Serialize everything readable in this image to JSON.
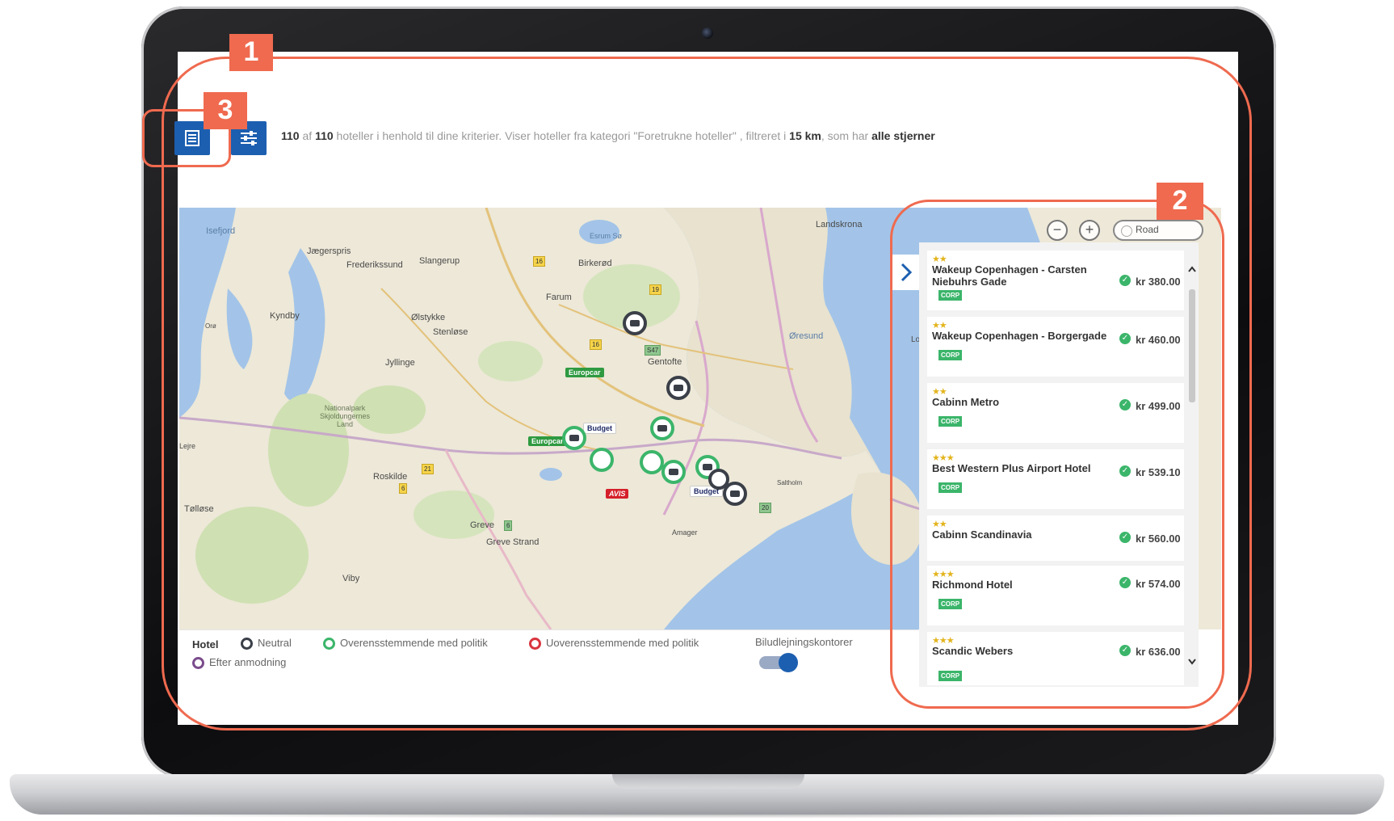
{
  "toolbar": {
    "list_view_icon": "list-icon",
    "filter_icon": "sliders-icon"
  },
  "summary": {
    "count_shown": "110",
    "of_text": "af",
    "count_total": "110",
    "text_a": "hoteller i henhold til dine kriterier. Viser hoteller fra kategori \"Foretrukne hoteller\" , filtreret i",
    "distance": "15 km",
    "text_b": ", som har",
    "stars": "alle stjerner"
  },
  "map": {
    "type_selector": "Road",
    "labels": [
      "Isefjord",
      "Jægerspris",
      "Frederikssund",
      "Slangerup",
      "Esrum Sø",
      "Birkerød",
      "Farum",
      "Kyndby",
      "Ølstykke",
      "Stenløse",
      "Jyllinge",
      "Nationalpark Skjoldungernes Land",
      "Gentofte",
      "Øresund",
      "Landskrona",
      "Roskilde",
      "Tølløse",
      "Greve",
      "Greve Strand",
      "Viby",
      "Amager",
      "Saltholm",
      "Europcar",
      "Budget",
      "AVIS",
      "Lejre",
      "Orø",
      "Lo"
    ],
    "road_numbers": [
      "16",
      "19",
      "16",
      "6",
      "21",
      "6",
      "20",
      "S47"
    ]
  },
  "legend": {
    "hotel_label": "Hotel",
    "neutral": "Neutral",
    "compliant": "Overensstemmende med politik",
    "noncompliant": "Uoverensstemmende med politik",
    "on_request": "Efter anmodning",
    "car_rental": "Biludlejningskontorer",
    "car_rental_toggle_on": true
  },
  "hotels": [
    {
      "stars": "★★",
      "name": "Wakeup Copenhagen - Carsten Niebuhrs Gade",
      "badge": "CORP",
      "price": "kr 380.00"
    },
    {
      "stars": "★★",
      "name": "Wakeup Copenhagen - Borgergade",
      "badge": "CORP",
      "price": "kr 460.00"
    },
    {
      "stars": "★★",
      "name": "Cabinn Metro",
      "badge": "CORP",
      "price": "kr 499.00"
    },
    {
      "stars": "★★★",
      "name": "Best Western Plus Airport Hotel",
      "badge": "CORP",
      "price": "kr 539.10"
    },
    {
      "stars": "★★",
      "name": "Cabinn Scandinavia",
      "badge": "",
      "price": "kr 560.00"
    },
    {
      "stars": "★★★",
      "name": "Richmond Hotel",
      "badge": "CORP",
      "price": "kr 574.00"
    },
    {
      "stars": "★★★",
      "name": "Scandic Webers",
      "badge": "CORP",
      "price": "kr 636.00"
    }
  ],
  "callouts": {
    "one": "1",
    "two": "2",
    "three": "3"
  },
  "colors": {
    "accent_blue": "#1c5fb0",
    "callout": "#ef6a4f",
    "compliant": "#3bb56a",
    "noncompliant": "#d9363e",
    "on_request": "#7b4c8c"
  }
}
